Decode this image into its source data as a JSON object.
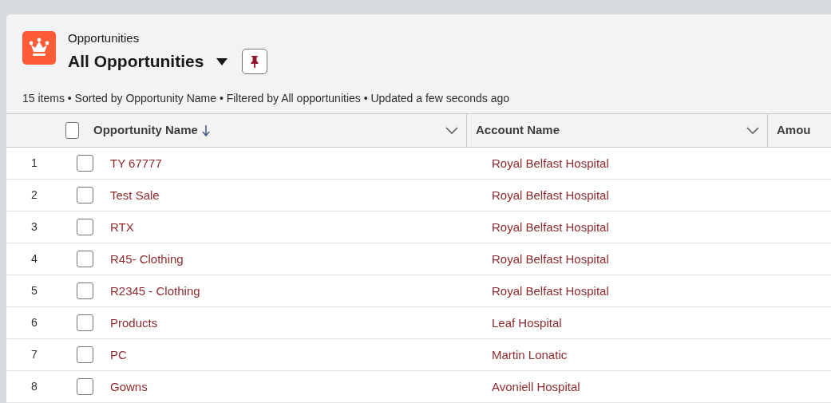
{
  "header": {
    "object_label": "Opportunities",
    "list_view": "All Opportunities",
    "status": "15 items • Sorted by Opportunity Name • Filtered by All opportunities • Updated a few seconds ago"
  },
  "table": {
    "select_all_checked": false,
    "columns": [
      {
        "label": "Opportunity Name",
        "sorted": true
      },
      {
        "label": "Account Name",
        "sorted": false
      },
      {
        "label": "Amou",
        "sorted": false
      }
    ],
    "rows": [
      {
        "number": "1",
        "checked": false,
        "opportunity": "TY 67777",
        "account": "Royal Belfast Hospital"
      },
      {
        "number": "2",
        "checked": false,
        "opportunity": "Test Sale",
        "account": "Royal Belfast Hospital"
      },
      {
        "number": "3",
        "checked": false,
        "opportunity": "RTX",
        "account": "Royal Belfast Hospital"
      },
      {
        "number": "4",
        "checked": false,
        "opportunity": "R45- Clothing",
        "account": "Royal Belfast Hospital"
      },
      {
        "number": "5",
        "checked": false,
        "opportunity": "R2345 - Clothing",
        "account": "Royal Belfast Hospital"
      },
      {
        "number": "6",
        "checked": false,
        "opportunity": "Products",
        "account": "Leaf Hospital"
      },
      {
        "number": "7",
        "checked": false,
        "opportunity": "PC",
        "account": "Martin Lonatic"
      },
      {
        "number": "8",
        "checked": false,
        "opportunity": "Gowns",
        "account": "Avoniell Hospital"
      }
    ]
  }
}
